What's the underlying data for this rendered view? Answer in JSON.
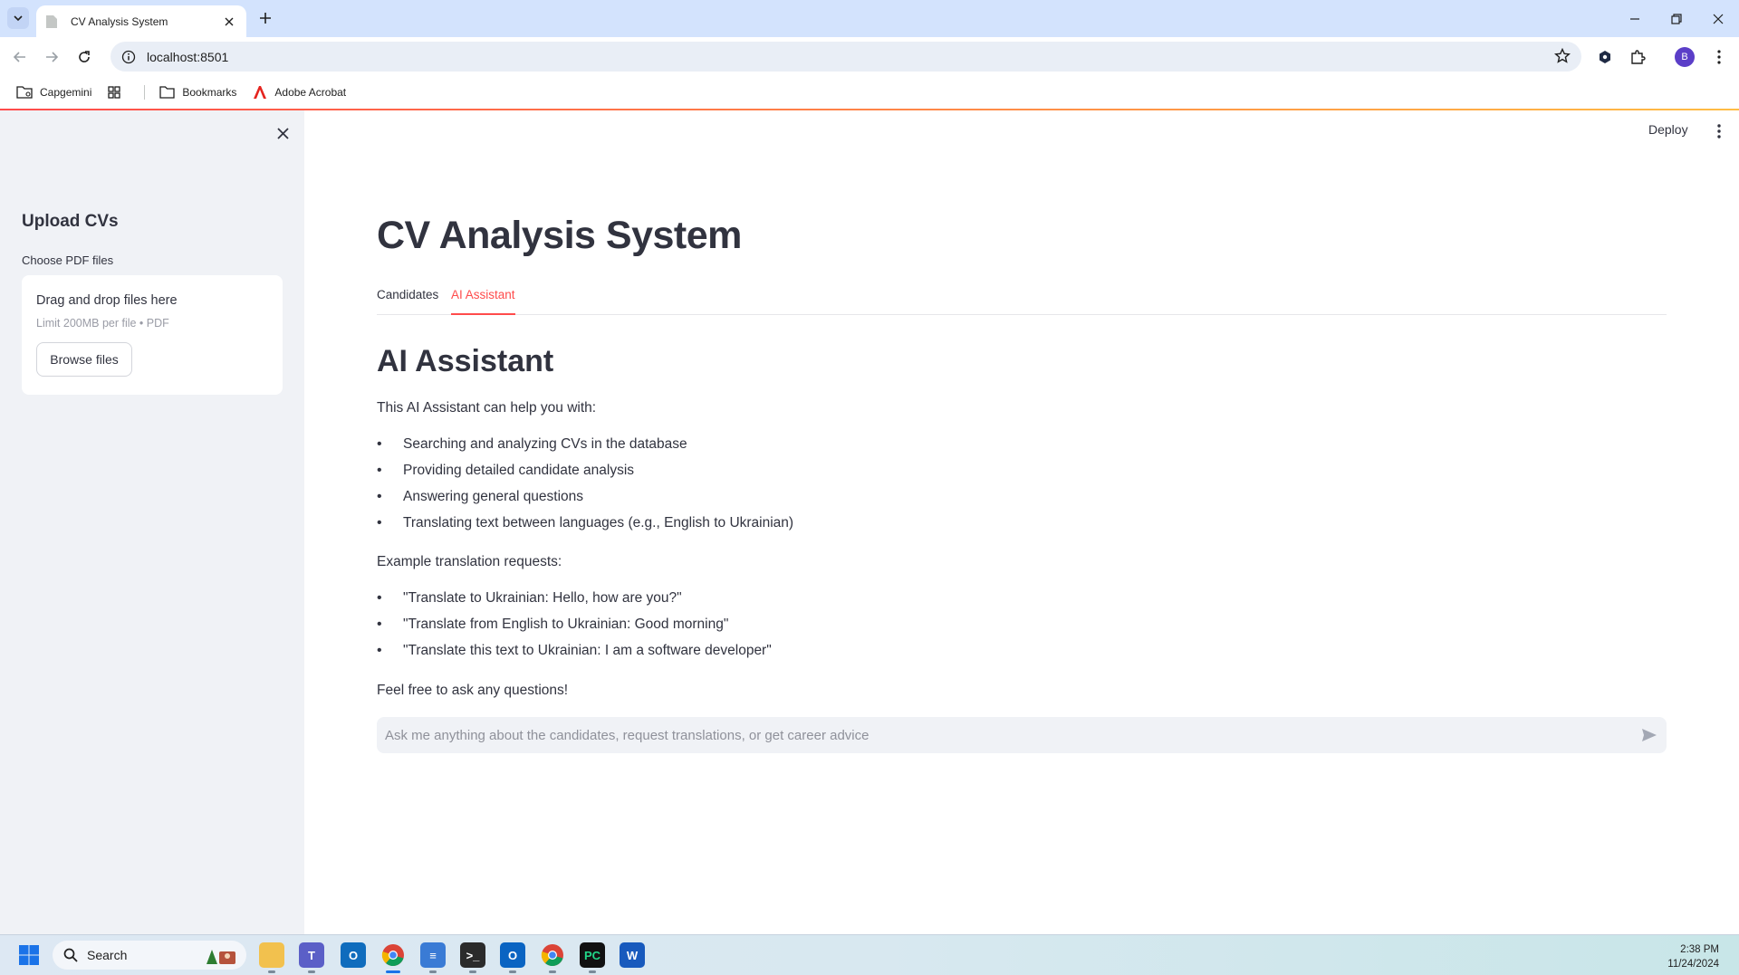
{
  "browser": {
    "tab_title": "CV Analysis System",
    "url": "localhost:8501",
    "profile_initial": "B",
    "bookmarks": [
      {
        "label": "Capgemini",
        "icon": "folder-icon"
      },
      {
        "label": "",
        "icon": "apps-grid-icon"
      },
      {
        "label": "Bookmarks",
        "icon": "folder-icon"
      },
      {
        "label": "Adobe Acrobat",
        "icon": "acrobat-icon"
      }
    ]
  },
  "app": {
    "deploy_label": "Deploy",
    "sidebar": {
      "heading": "Upload CVs",
      "uploader_label": "Choose PDF files",
      "dropzone_title": "Drag and drop files here",
      "dropzone_limit": "Limit 200MB per file • PDF",
      "browse_button": "Browse files"
    },
    "title": "CV Analysis System",
    "tabs": [
      {
        "label": "Candidates",
        "active": false
      },
      {
        "label": "AI Assistant",
        "active": true
      }
    ],
    "assistant": {
      "heading": "AI Assistant",
      "intro": "This AI Assistant can help you with:",
      "capabilities": [
        "Searching and analyzing CVs in the database",
        "Providing detailed candidate analysis",
        "Answering general questions",
        "Translating text between languages (e.g., English to Ukrainian)"
      ],
      "examples_intro": "Example translation requests:",
      "examples": [
        "\"Translate to Ukrainian: Hello, how are you?\"",
        "\"Translate from English to Ukrainian: Good morning\"",
        "\"Translate this text to Ukrainian: I am a software developer\""
      ],
      "outro": "Feel free to ask any questions!",
      "chat_placeholder": "Ask me anything about the candidates, request translations, or get career advice"
    },
    "colors": {
      "accent": "#ff4b4b",
      "sidebar_bg": "#f0f2f6",
      "text": "#31333f"
    }
  },
  "taskbar": {
    "search_label": "Search",
    "time": "2:38 PM",
    "date": "11/24/2024",
    "apps": [
      "windows-start-icon",
      "file-explorer-icon",
      "teams-icon",
      "outlook-icon",
      "chrome-icon",
      "notepad-icon",
      "terminal-icon",
      "outlook-new-icon",
      "chrome-profile-icon",
      "pycharm-icon",
      "word-icon"
    ]
  }
}
